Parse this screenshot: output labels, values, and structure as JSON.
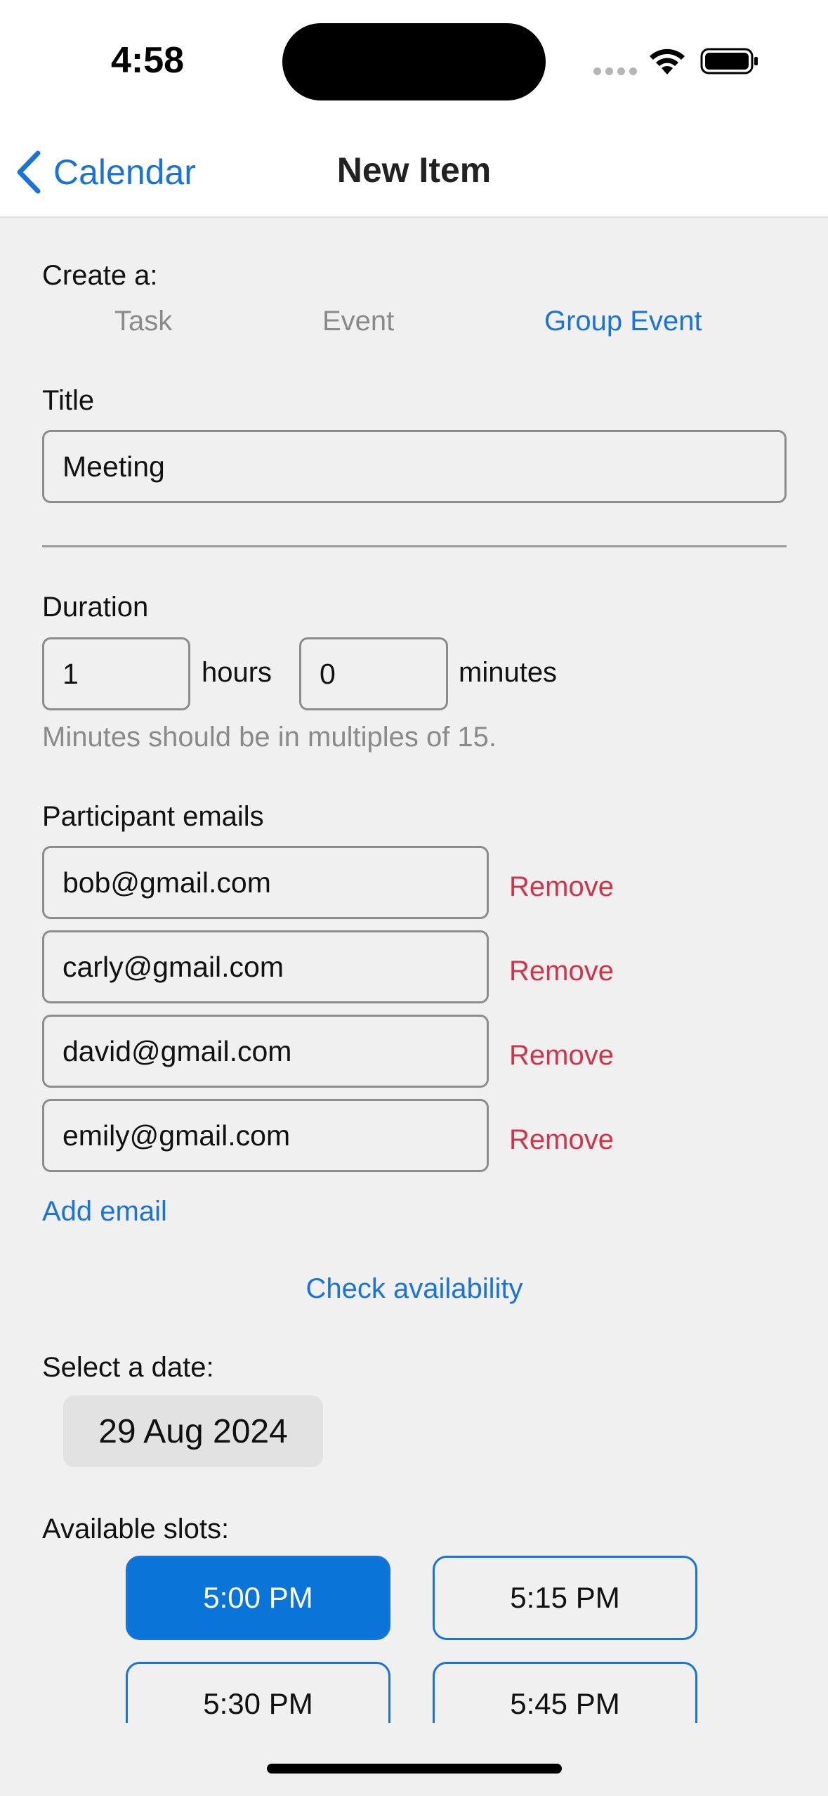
{
  "status_bar": {
    "time": "4:58"
  },
  "nav": {
    "back_label": "Calendar",
    "title": "New Item"
  },
  "create": {
    "label": "Create a:",
    "options": [
      "Task",
      "Event",
      "Group Event"
    ],
    "selected": "Group Event"
  },
  "title_field": {
    "label": "Title",
    "value": "Meeting"
  },
  "duration": {
    "label": "Duration",
    "hours_value": "1",
    "hours_label": "hours",
    "minutes_value": "0",
    "minutes_label": "minutes",
    "hint": "Minutes should be in multiples of 15."
  },
  "participants": {
    "label": "Participant emails",
    "emails": [
      "bob@gmail.com",
      "carly@gmail.com",
      "david@gmail.com",
      "emily@gmail.com"
    ],
    "remove_label": "Remove",
    "add_label": "Add email"
  },
  "check_availability_label": "Check availability",
  "date": {
    "label": "Select a date:",
    "value": "29 Aug 2024"
  },
  "slots": {
    "label": "Available slots:",
    "items": [
      "5:00 PM",
      "5:15 PM",
      "5:30 PM",
      "5:45 PM"
    ],
    "selected": "5:00 PM"
  },
  "colors": {
    "accent": "#1a73d9",
    "destructive": "#d0344a",
    "selected_slot": "#0a74d8"
  }
}
